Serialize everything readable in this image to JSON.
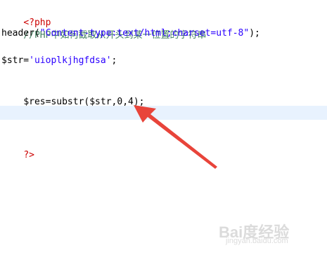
{
  "editor": {
    "lines": {
      "l1": {
        "open_tag": "<?php"
      },
      "l2": {
        "comment": "//PHP中如何截取从开头到某一位置的字符串"
      },
      "l3": {
        "func": "header(",
        "string": "\"Content-type:text/html;charset=utf-8\"",
        "end": ");"
      },
      "l5": {
        "var": "$str=",
        "string": "'uioplkjhgfdsa'",
        "end": ";"
      },
      "l7": {
        "code": "$res=substr($str,0,4);"
      },
      "l10": {
        "close_tag": "?>"
      }
    }
  },
  "watermark": {
    "logo": "Bai度经验",
    "sub": "jingyan.baidu.com"
  },
  "colors": {
    "tag": "#cc0000",
    "comment": "#3f7f5f",
    "string": "#2a00ff",
    "current_line": "#e8f2fe",
    "arrow": "#e8443a"
  }
}
